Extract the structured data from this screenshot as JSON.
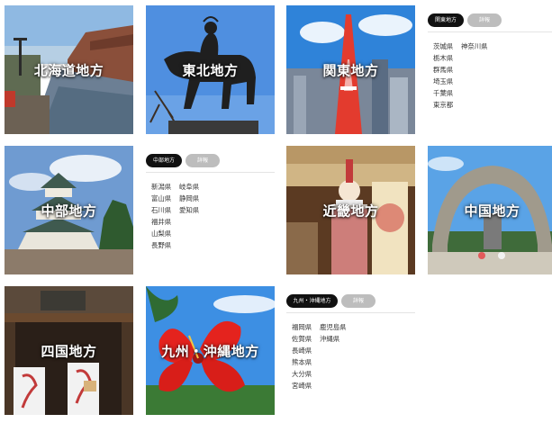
{
  "regions": [
    {
      "id": "hokkaido",
      "label": "北海道地方"
    },
    {
      "id": "tohoku",
      "label": "東北地方"
    },
    {
      "id": "kanto",
      "label": "関東地方"
    },
    {
      "id": "chubu",
      "label": "中部地方"
    },
    {
      "id": "kinki",
      "label": "近畿地方"
    },
    {
      "id": "chugoku",
      "label": "中国地方"
    },
    {
      "id": "shikoku",
      "label": "四国地方"
    },
    {
      "id": "kyushu",
      "label": "九州・沖縄地方"
    }
  ],
  "panels": {
    "kanto": {
      "tab": "関東地方",
      "detail": "詳報",
      "prefectures": [
        "茨城県",
        "神奈川県",
        "栃木県",
        "群馬県",
        "埼玉県",
        "千葉県",
        "東京都"
      ]
    },
    "chubu": {
      "tab": "中部地方",
      "detail": "詳報",
      "prefectures": [
        "新潟県",
        "岐阜県",
        "富山県",
        "静岡県",
        "石川県",
        "愛知県",
        "福井県",
        "山梨県",
        "長野県"
      ]
    },
    "kyushu": {
      "tab": "九州・沖縄地方",
      "detail": "詳報",
      "prefectures": [
        "福岡県",
        "鹿児島県",
        "佐賀県",
        "沖縄県",
        "長崎県",
        "熊本県",
        "大分県",
        "宮崎県"
      ]
    }
  }
}
